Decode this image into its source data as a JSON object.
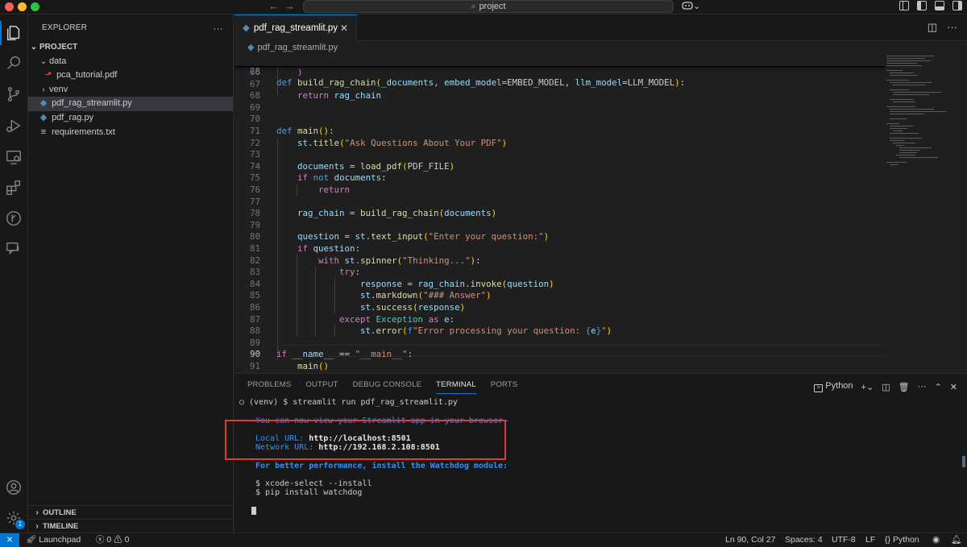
{
  "titlebar": {
    "search_text": "project",
    "back_arrow": "←",
    "forward_arrow": "→",
    "copilot_caret": "⌄"
  },
  "activity": {
    "settings_badge": "1"
  },
  "sidebar": {
    "title": "EXPLORER",
    "more": "···",
    "project_label": "PROJECT",
    "tree": [
      {
        "label": "data",
        "kind": "folder-open"
      },
      {
        "label": "pca_tutorial.pdf",
        "kind": "pdf"
      },
      {
        "label": "venv",
        "kind": "folder"
      },
      {
        "label": "pdf_rag_streamlit.py",
        "kind": "py",
        "selected": true
      },
      {
        "label": "pdf_rag.py",
        "kind": "py"
      },
      {
        "label": "requirements.txt",
        "kind": "txt"
      }
    ],
    "outline_label": "OUTLINE",
    "timeline_label": "TIMELINE"
  },
  "editor": {
    "tab_label": "pdf_rag_streamlit.py",
    "breadcrumb": "pdf_rag_streamlit.py",
    "sticky_line": "28",
    "line_numbers": [
      "66",
      "67",
      "68",
      "69",
      "70",
      "71",
      "72",
      "73",
      "74",
      "75",
      "76",
      "77",
      "78",
      "79",
      "80",
      "81",
      "82",
      "83",
      "84",
      "85",
      "86",
      "87",
      "88",
      "89",
      "90",
      "91"
    ],
    "current_line": "90"
  },
  "panel": {
    "tabs": [
      "PROBLEMS",
      "OUTPUT",
      "DEBUG CONSOLE",
      "TERMINAL",
      "PORTS"
    ],
    "active_tab": "TERMINAL",
    "shell_label": "Python",
    "terminal": {
      "command": "○ (venv) $ streamlit run pdf_rag_streamlit.py",
      "view_msg": "You can now view your Streamlit app in your browser.",
      "local_label": "Local URL: ",
      "local_url": "http://localhost:8501",
      "network_label": "Network URL: ",
      "network_url": "http://192.168.2.108:8501",
      "perf_msg": "For better performance, install the Watchdog module:",
      "cmd1": "$ xcode-select --install",
      "cmd2": "$ pip install watchdog"
    }
  },
  "statusbar": {
    "launchpad": "Launchpad",
    "errors": "0",
    "warnings": "0",
    "position": "Ln 90, Col 27",
    "spaces": "Spaces: 4",
    "encoding": "UTF-8",
    "eol": "LF",
    "language": "Python"
  }
}
